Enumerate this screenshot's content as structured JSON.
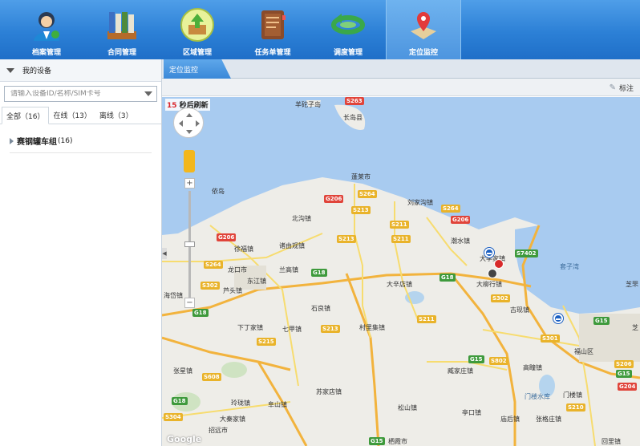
{
  "nav": {
    "items": [
      {
        "label": "档案管理",
        "icon": "user-profile-icon"
      },
      {
        "label": "合同管理",
        "icon": "binders-icon"
      },
      {
        "label": "区域管理",
        "icon": "box-upload-icon"
      },
      {
        "label": "任务单管理",
        "icon": "notebook-icon"
      },
      {
        "label": "调度管理",
        "icon": "circular-arrow-icon"
      },
      {
        "label": "定位监控",
        "icon": "map-pin-icon"
      }
    ],
    "active_index": 5
  },
  "sidebar": {
    "header_label": "我的设备",
    "search_placeholder": "请输入设备ID/名称/SIM卡号",
    "tabs": [
      {
        "label": "全部（16）"
      },
      {
        "label": "在线（13）"
      },
      {
        "label": "离线（3）"
      }
    ],
    "tree": {
      "group_label": "赛钢罐车组",
      "group_count": "(16)"
    }
  },
  "content": {
    "tab_label": "定位监控",
    "toolbar_mark_label": "标注"
  },
  "map": {
    "refresh_number": "15",
    "refresh_text": "秒后刷新",
    "google_label": "Google",
    "places": [
      {
        "name": "羊砣子岛"
      },
      {
        "name": "长岛县"
      },
      {
        "name": "蓬莱市"
      },
      {
        "name": "依岛"
      },
      {
        "name": "刘家沟镇"
      },
      {
        "name": "北沟镇"
      },
      {
        "name": "徐福镇"
      },
      {
        "name": "诸由观镇"
      },
      {
        "name": "潮水镇"
      },
      {
        "name": "大季家镇"
      },
      {
        "name": "套子湾"
      },
      {
        "name": "龙口市"
      },
      {
        "name": "兰高镇"
      },
      {
        "name": "东江镇"
      },
      {
        "name": "芦头镇"
      },
      {
        "name": "大辛店镇"
      },
      {
        "name": "大柳行镇"
      },
      {
        "name": "古现镇"
      },
      {
        "name": "海岱镇"
      },
      {
        "name": "石良镇"
      },
      {
        "name": "下丁家镇"
      },
      {
        "name": "七甲镇"
      },
      {
        "name": "村里集镇"
      },
      {
        "name": "福山区"
      },
      {
        "name": "张星镇"
      },
      {
        "name": "臧家庄镇"
      },
      {
        "name": "高疃镇"
      },
      {
        "name": "苏家店镇"
      },
      {
        "name": "玲珑镇"
      },
      {
        "name": "阜山镇"
      },
      {
        "name": "门楼水库"
      },
      {
        "name": "门楼镇"
      },
      {
        "name": "松山镇"
      },
      {
        "name": "亭口镇"
      },
      {
        "name": "大秦家镇"
      },
      {
        "name": "庙后镇"
      },
      {
        "name": "张格庄镇"
      },
      {
        "name": "招远市"
      },
      {
        "name": "栖霞市"
      },
      {
        "name": "芝罘"
      },
      {
        "name": "芝"
      },
      {
        "name": "回里镇"
      }
    ],
    "road_shields": [
      {
        "label": "S263",
        "kind": "red"
      },
      {
        "label": "G206",
        "kind": "red"
      },
      {
        "label": "S264",
        "kind": "yellow"
      },
      {
        "label": "S213",
        "kind": "yellow"
      },
      {
        "label": "S211",
        "kind": "yellow"
      },
      {
        "label": "S264",
        "kind": "yellow"
      },
      {
        "label": "G206",
        "kind": "red"
      },
      {
        "label": "S213",
        "kind": "yellow"
      },
      {
        "label": "S211",
        "kind": "yellow"
      },
      {
        "label": "G206",
        "kind": "red"
      },
      {
        "label": "S264",
        "kind": "yellow"
      },
      {
        "label": "G18",
        "kind": "green"
      },
      {
        "label": "S302",
        "kind": "yellow"
      },
      {
        "label": "G18",
        "kind": "green"
      },
      {
        "label": "G18",
        "kind": "green"
      },
      {
        "label": "S7402",
        "kind": "green"
      },
      {
        "label": "S302",
        "kind": "yellow"
      },
      {
        "label": "S213",
        "kind": "yellow"
      },
      {
        "label": "S211",
        "kind": "yellow"
      },
      {
        "label": "S215",
        "kind": "yellow"
      },
      {
        "label": "G15",
        "kind": "green"
      },
      {
        "label": "S301",
        "kind": "yellow"
      },
      {
        "label": "G15",
        "kind": "green"
      },
      {
        "label": "S802",
        "kind": "yellow"
      },
      {
        "label": "S608",
        "kind": "yellow"
      },
      {
        "label": "G18",
        "kind": "green"
      },
      {
        "label": "S304",
        "kind": "yellow"
      },
      {
        "label": "S210",
        "kind": "yellow"
      },
      {
        "label": "G15",
        "kind": "green"
      },
      {
        "label": "S206",
        "kind": "yellow"
      },
      {
        "label": "G204",
        "kind": "red"
      },
      {
        "label": "G15",
        "kind": "green"
      }
    ],
    "colors": {
      "sea": "#a8cbf0",
      "land": "#eeede8",
      "highway": "#f2b33d",
      "road": "#f7dc6f"
    }
  }
}
